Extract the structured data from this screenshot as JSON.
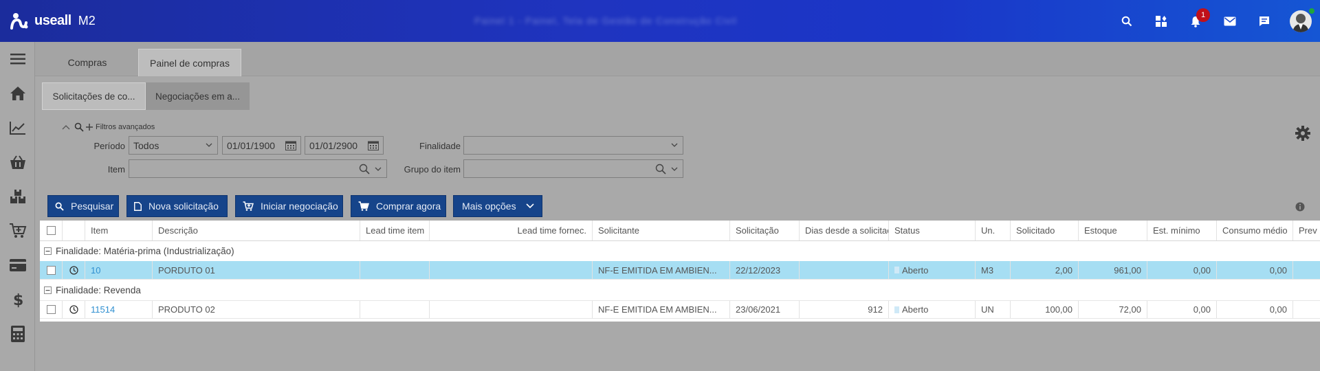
{
  "app": {
    "logo_text": "useall",
    "logo_suffix": "M2",
    "page_title": "Painel 1 - Painel, Tela de Gestão de Construção Civil",
    "notification_count": "1"
  },
  "main_tabs": [
    {
      "label": "Compras"
    },
    {
      "label": "Painel de compras"
    }
  ],
  "sub_tabs": [
    {
      "label": "Solicitações de co..."
    },
    {
      "label": "Negociações em a..."
    }
  ],
  "filters": {
    "toggle_label": "Filtros avançados",
    "periodo_label": "Período",
    "periodo_value": "Todos",
    "date_from": "01/01/1900",
    "date_to": "01/01/2900",
    "finalidade_label": "Finalidade",
    "finalidade_value": "",
    "item_label": "Item",
    "item_value": "",
    "grupo_label": "Grupo do item",
    "grupo_value": ""
  },
  "buttons": {
    "pesquisar": "Pesquisar",
    "nova_solicitacao": "Nova solicitação",
    "iniciar_negociacao": "Iniciar negociação",
    "comprar_agora": "Comprar agora",
    "mais_opcoes": "Mais opções"
  },
  "grid": {
    "columns": {
      "item": "Item",
      "descricao": "Descrição",
      "lead_item": "Lead time item",
      "lead_fornec": "Lead time fornec.",
      "solicitante": "Solicitante",
      "solicitacao": "Solicitação",
      "dias": "Dias desde a solicitação",
      "status": "Status",
      "un": "Un.",
      "solicitado": "Solicitado",
      "estoque": "Estoque",
      "est_minimo": "Est. mínimo",
      "consumo": "Consumo médio",
      "prev": "Prev"
    },
    "groups": [
      {
        "title": "Finalidade: Matéria-prima (Industrialização)",
        "rows": [
          {
            "item": "10",
            "descricao": "PORDUTO 01",
            "lead_item": "",
            "lead_fornec": "",
            "solicitante": "NF-E EMITIDA EM AMBIEN...",
            "solicitacao": "22/12/2023",
            "dias": "",
            "status": "Aberto",
            "un": "M3",
            "solicitado": "2,00",
            "estoque": "961,00",
            "est_minimo": "0,00",
            "consumo": "0,00"
          }
        ]
      },
      {
        "title": "Finalidade: Revenda",
        "rows": [
          {
            "item": "11514",
            "descricao": "PRODUTO 02",
            "lead_item": "",
            "lead_fornec": "",
            "solicitante": "NF-E EMITIDA EM AMBIEN...",
            "solicitacao": "23/06/2021",
            "dias": "912",
            "status": "Aberto",
            "un": "UN",
            "solicitado": "100,00",
            "estoque": "72,00",
            "est_minimo": "0,00",
            "consumo": "0,00"
          }
        ]
      }
    ]
  },
  "colors": {
    "header_start": "#1b2c9c",
    "header_end": "#1556d4",
    "button": "#16448a",
    "selected_row": "#a6def3",
    "link": "#2f8fd0",
    "badge": "#c0101a"
  }
}
